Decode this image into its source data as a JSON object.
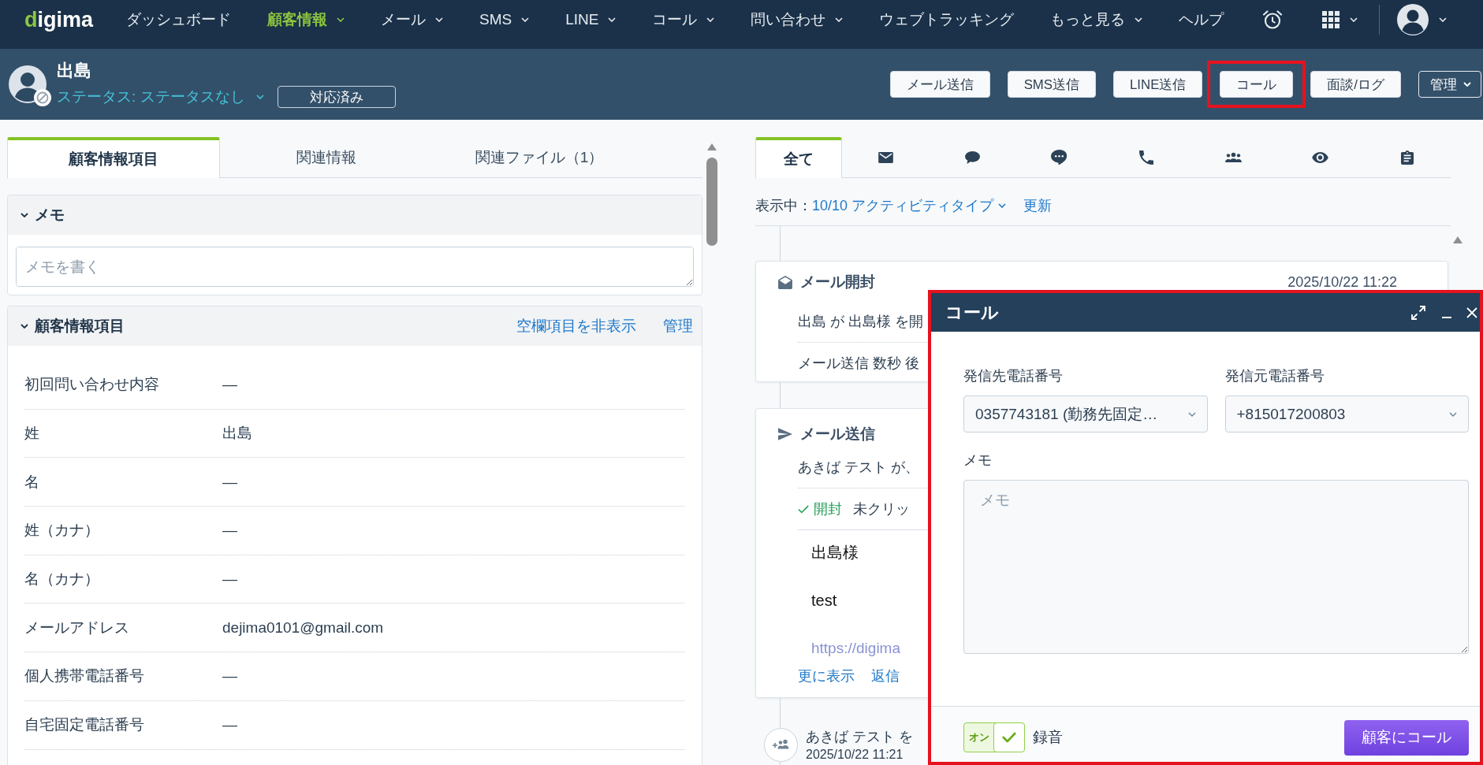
{
  "top_nav": {
    "logo": "digima",
    "items": [
      {
        "label": "ダッシュボード",
        "selected": false,
        "has_menu": false
      },
      {
        "label": "顧客情報",
        "selected": true,
        "has_menu": true
      },
      {
        "label": "メール",
        "selected": false,
        "has_menu": true
      },
      {
        "label": "SMS",
        "selected": false,
        "has_menu": true
      },
      {
        "label": "LINE",
        "selected": false,
        "has_menu": true
      },
      {
        "label": "コール",
        "selected": false,
        "has_menu": true
      },
      {
        "label": "問い合わせ",
        "selected": false,
        "has_menu": true
      },
      {
        "label": "ウェブトラッキング",
        "selected": false,
        "has_menu": false
      },
      {
        "label": "もっと見る",
        "selected": false,
        "has_menu": true
      },
      {
        "label": "ヘルプ",
        "selected": false,
        "has_menu": false
      }
    ]
  },
  "record_header": {
    "name": "出島",
    "status": "ステータス: ステータスなし",
    "status_button": "対応済み",
    "actions": [
      {
        "label": "メール送信",
        "kind": "button",
        "highlighted": false
      },
      {
        "label": "SMS送信",
        "kind": "button",
        "highlighted": false
      },
      {
        "label": "LINE送信",
        "kind": "button",
        "highlighted": false
      },
      {
        "label": "コール",
        "kind": "button",
        "highlighted": true
      },
      {
        "label": "面談/ログ",
        "kind": "button",
        "highlighted": false
      },
      {
        "label": "管理",
        "kind": "menu",
        "highlighted": false
      }
    ]
  },
  "left_panel": {
    "tabs": [
      {
        "label": "顧客情報項目",
        "selected": true
      },
      {
        "label": "関連情報",
        "selected": false
      },
      {
        "label": "関連ファイル（1）",
        "selected": false
      }
    ],
    "memo": {
      "title": "メモ",
      "expanded": true,
      "placeholder": "メモを書く"
    },
    "customer_info": {
      "title": "顧客情報項目",
      "expanded": true,
      "links": [
        "空欄項目を非表示",
        "管理"
      ],
      "rows": [
        {
          "label": "初回問い合わせ内容",
          "value": "—"
        },
        {
          "label": "姓",
          "value": "出島"
        },
        {
          "label": "名",
          "value": "—"
        },
        {
          "label": "姓（カナ）",
          "value": "—"
        },
        {
          "label": "名（カナ）",
          "value": "—"
        },
        {
          "label": "メールアドレス",
          "value": "dejima0101@gmail.com"
        },
        {
          "label": "個人携帯電話番号",
          "value": "—"
        },
        {
          "label": "自宅固定電話番号",
          "value": "—"
        }
      ]
    }
  },
  "activity_panel": {
    "tabs": [
      {
        "kind": "all",
        "label": "全て",
        "selected": true
      },
      {
        "kind": "email",
        "selected": false
      },
      {
        "kind": "sms",
        "selected": false
      },
      {
        "kind": "line",
        "selected": false
      },
      {
        "kind": "call",
        "selected": false
      },
      {
        "kind": "meeting",
        "selected": false
      },
      {
        "kind": "web",
        "selected": false
      },
      {
        "kind": "note",
        "selected": false
      }
    ],
    "filter": {
      "prefix": "表示中：",
      "value": "10/10 アクティビティタイプ",
      "refresh": "更新"
    },
    "activities": [
      {
        "kind": "mail_open",
        "title": "メール開封",
        "time": "2025/10/22 11:22",
        "lines": [
          "出島 が 出島様 を開",
          "メール送信 数秒 後"
        ]
      },
      {
        "kind": "mail_sent",
        "title": "メール送信",
        "summary": "あきば テスト が、",
        "opened": true,
        "opened_label": "開封",
        "click_status": "未クリッ",
        "body": [
          "出島様",
          "test"
        ],
        "faded_line": "https://digima",
        "links": [
          "更に表示",
          "返信"
        ]
      },
      {
        "kind": "contact_added",
        "text": "あきば テスト を",
        "time": "2025/10/22 11:21"
      }
    ]
  },
  "call_dialog": {
    "title": "コール",
    "highlighted": true,
    "fields": [
      {
        "label": "発信先電話番号",
        "value": "0357743181 (勤務先固定…"
      },
      {
        "label": "発信元電話番号",
        "value": "+815017200803"
      }
    ],
    "memo_label": "メモ",
    "memo_placeholder": "メモ",
    "recording": {
      "on": true,
      "on_label": "オン",
      "label": "録音"
    },
    "call_button": "顧客にコール"
  }
}
